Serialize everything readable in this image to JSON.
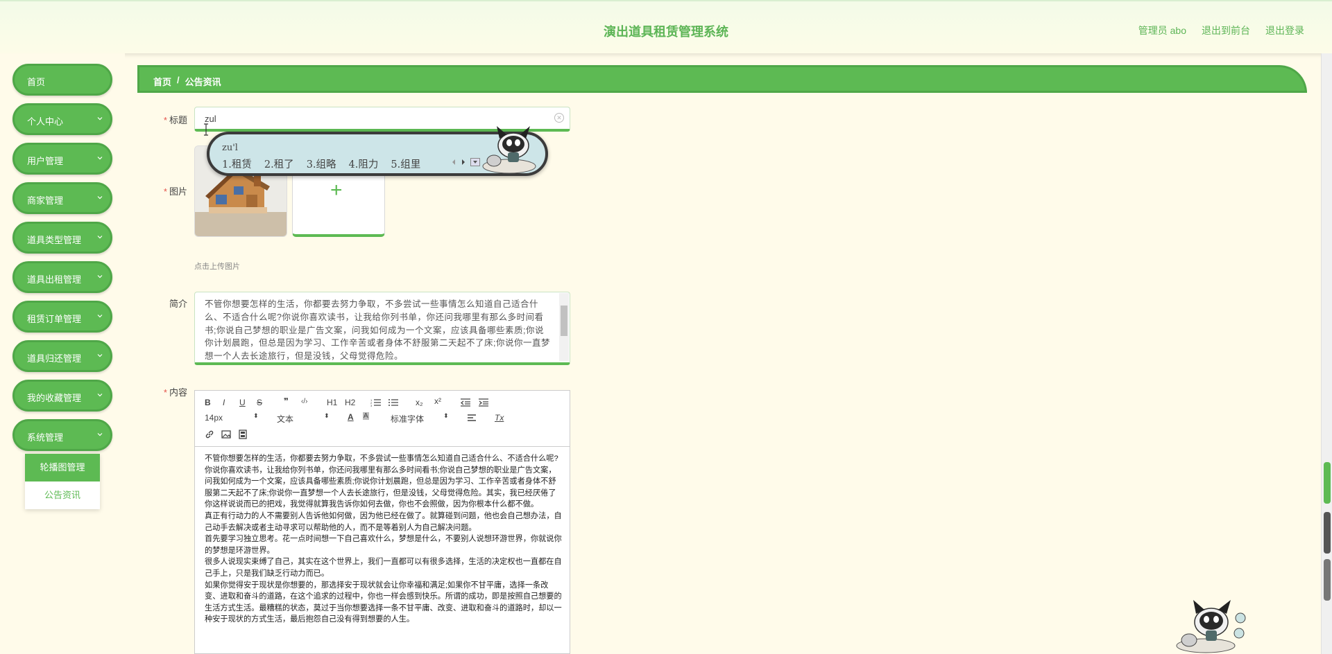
{
  "header": {
    "title": "演出道具租赁管理系统",
    "admin_label": "管理员 abo",
    "front_link": "退出到前台",
    "logout_link": "退出登录"
  },
  "sidebar": {
    "items": [
      {
        "label": "首页",
        "has_chevron": false
      },
      {
        "label": "个人中心",
        "has_chevron": true
      },
      {
        "label": "用户管理",
        "has_chevron": true
      },
      {
        "label": "商家管理",
        "has_chevron": true
      },
      {
        "label": "道具类型管理",
        "has_chevron": true
      },
      {
        "label": "道具出租管理",
        "has_chevron": true
      },
      {
        "label": "租赁订单管理",
        "has_chevron": true
      },
      {
        "label": "道具归还管理",
        "has_chevron": true
      },
      {
        "label": "我的收藏管理",
        "has_chevron": true
      },
      {
        "label": "系统管理",
        "has_chevron": true
      }
    ],
    "submenu": [
      "轮播图管理",
      "公告资讯"
    ]
  },
  "breadcrumb": {
    "home": "首页",
    "sep": "/",
    "current": "公告资讯"
  },
  "form": {
    "title_label": "标题",
    "title_value": "zul",
    "image_label": "图片",
    "upload_tip": "点击上传图片",
    "intro_label": "简介",
    "intro_value": "不管你想要怎样的生活，你都要去努力争取，不多尝试一些事情怎么知道自己适合什么、不适合什么呢?你说你喜欢读书，让我给你列书单，你还问我哪里有那么多时间看书;你说自己梦想的职业是广告文案，问我如何成为一个文案，应该具备哪些素质;你说你计划晨跑，但总是因为学习、工作辛苦或者身体不舒服第二天起不了床;你说你一直梦想一个人去长途旅行，但是没钱，父母觉得危险。",
    "content_label": "内容"
  },
  "editor": {
    "toolbar": {
      "bold": "B",
      "italic": "I",
      "underline": "U",
      "strike": "S",
      "quote": "❞",
      "code": "‹/›",
      "h1": "H1",
      "h2": "H2",
      "sub": "x₂",
      "sup": "x²",
      "size": "14px",
      "type": "文本",
      "font": "标准字体",
      "clean": "Tx"
    },
    "paragraphs": [
      "不管你想要怎样的生活，你都要去努力争取，不多尝试一些事情怎么知道自己适合什么、不适合什么呢?",
      "你说你喜欢读书，让我给你列书单，你还问我哪里有那么多时间看书;你说自己梦想的职业是广告文案，问我如何成为一个文案，应该具备哪些素质;你说你计划晨跑，但总是因为学习、工作辛苦或者身体不舒服第二天起不了床;你说你一直梦想一个人去长途旅行，但是没钱，父母觉得危险。其实，我已经厌倦了你这样说说而已的把戏，我觉得就算我告诉你如何去做，你也不会照做，因为你根本什么都不做。",
      "真正有行动力的人不需要别人告诉他如何做，因为他已经在做了。就算碰到问题，他也会自己想办法，自己动手去解决或者主动寻求可以帮助他的人，而不是等着别人为自己解决问题。",
      "首先要学习独立思考。花一点时间想一下自己喜欢什么，梦想是什么，不要别人说想环游世界，你就说你的梦想是环游世界。",
      "很多人说现实束缚了自己，其实在这个世界上，我们一直都可以有很多选择，生活的决定权也一直都在自己手上，只是我们缺乏行动力而已。",
      "如果你觉得安于现状是你想要的，那选择安于现状就会让你幸福和满足;如果你不甘平庸，选择一条改变、进取和奋斗的道路，在这个追求的过程中，你也一样会感到快乐。所谓的成功，即是按照自己想要的生活方式生活。最糟糕的状态，莫过于当你想要选择一条不甘平庸、改变、进取和奋斗的道路时，却以一种安于现状的方式生活，最后抱怨自己没有得到想要的人生。"
    ]
  },
  "ime": {
    "pinyin": "zu'l",
    "candidates": [
      "1.租赁",
      "2.租了",
      "3.组略",
      "4.阻力",
      "5.组里"
    ]
  },
  "colors": {
    "accent": "#5dba53",
    "accent_dark": "#4fa748",
    "background": "#fffbea"
  }
}
